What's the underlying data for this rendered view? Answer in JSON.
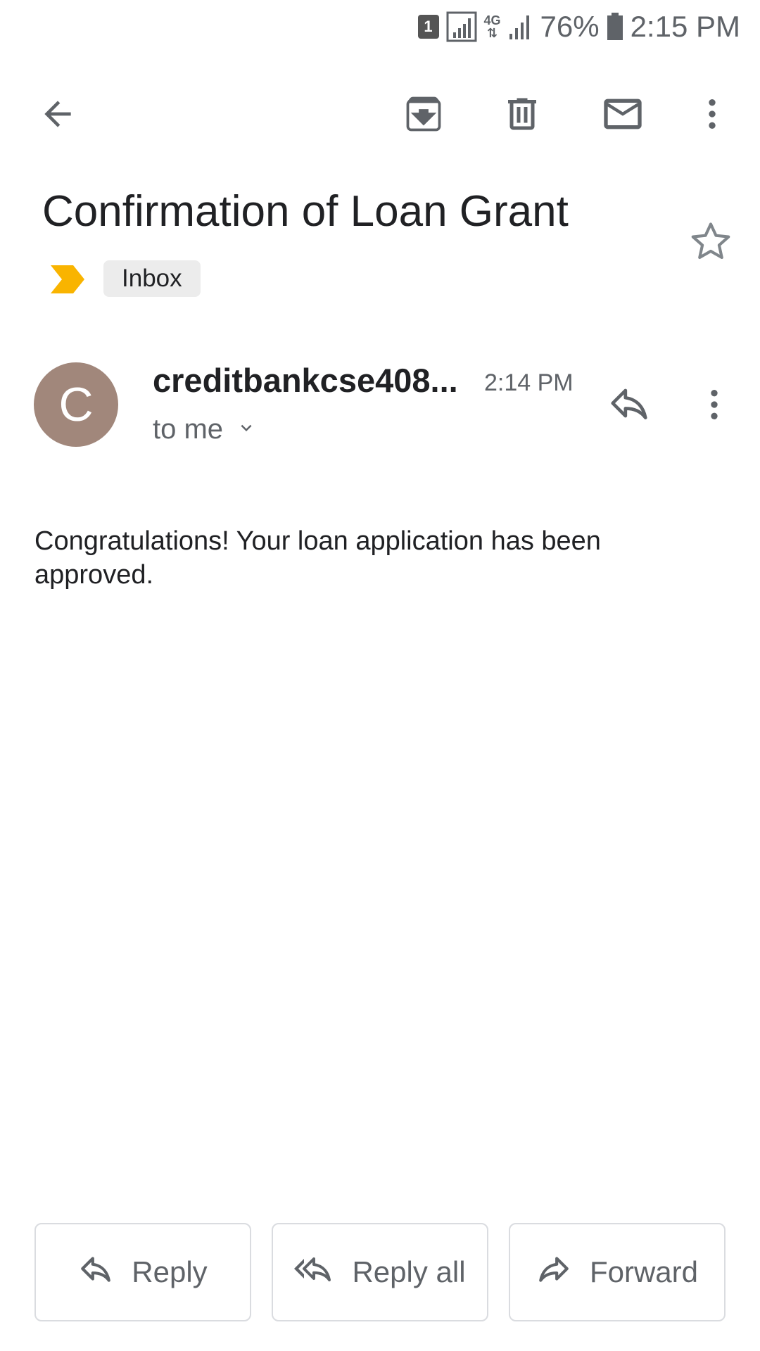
{
  "status_bar": {
    "sim_badge": "1",
    "network_type": "4G",
    "battery_percent": "76%",
    "time": "2:15 PM"
  },
  "toolbar": {
    "back_icon": "arrow-back-icon",
    "archive_icon": "archive-icon",
    "delete_icon": "trash-icon",
    "mark_unread_icon": "mail-icon",
    "more_icon": "more-vert-icon"
  },
  "email": {
    "subject": "Confirmation of Loan Grant",
    "label": "Inbox",
    "importance_color": "#f9b400",
    "sender": {
      "avatar_letter": "C",
      "avatar_color": "#a1877b",
      "name": "creditbankcse408...",
      "time": "2:14 PM",
      "recipient": "to me"
    },
    "body": "Congratulations! Your loan application has been approved."
  },
  "actions": {
    "reply": "Reply",
    "reply_all": "Reply all",
    "forward": "Forward"
  }
}
